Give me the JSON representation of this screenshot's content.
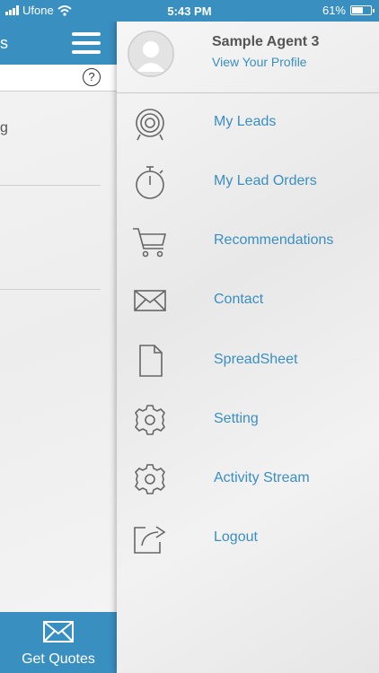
{
  "status_bar": {
    "carrier": "Ufone",
    "time": "5:43 PM",
    "battery": "61%",
    "battery_level": 0.61
  },
  "background_page": {
    "header_title": "s",
    "left_glyph": "g",
    "help_symbol": "?",
    "get_quotes_label": "Get Quotes"
  },
  "profile": {
    "name": "Sample Agent 3",
    "link": "View Your Profile"
  },
  "menu": {
    "items": [
      {
        "label": "My Leads",
        "icon": "target-icon"
      },
      {
        "label": "My Lead Orders",
        "icon": "stopwatch-icon"
      },
      {
        "label": "Recommendations",
        "icon": "cart-icon"
      },
      {
        "label": "Contact",
        "icon": "envelope-icon"
      },
      {
        "label": "SpreadSheet",
        "icon": "document-icon"
      },
      {
        "label": "Setting",
        "icon": "gear-icon"
      },
      {
        "label": "Activity Stream",
        "icon": "gear-icon"
      },
      {
        "label": "Logout",
        "icon": "share-icon"
      }
    ]
  },
  "colors": {
    "accent": "#3a8fc1",
    "text_dark": "#555555",
    "icon": "#666666"
  }
}
